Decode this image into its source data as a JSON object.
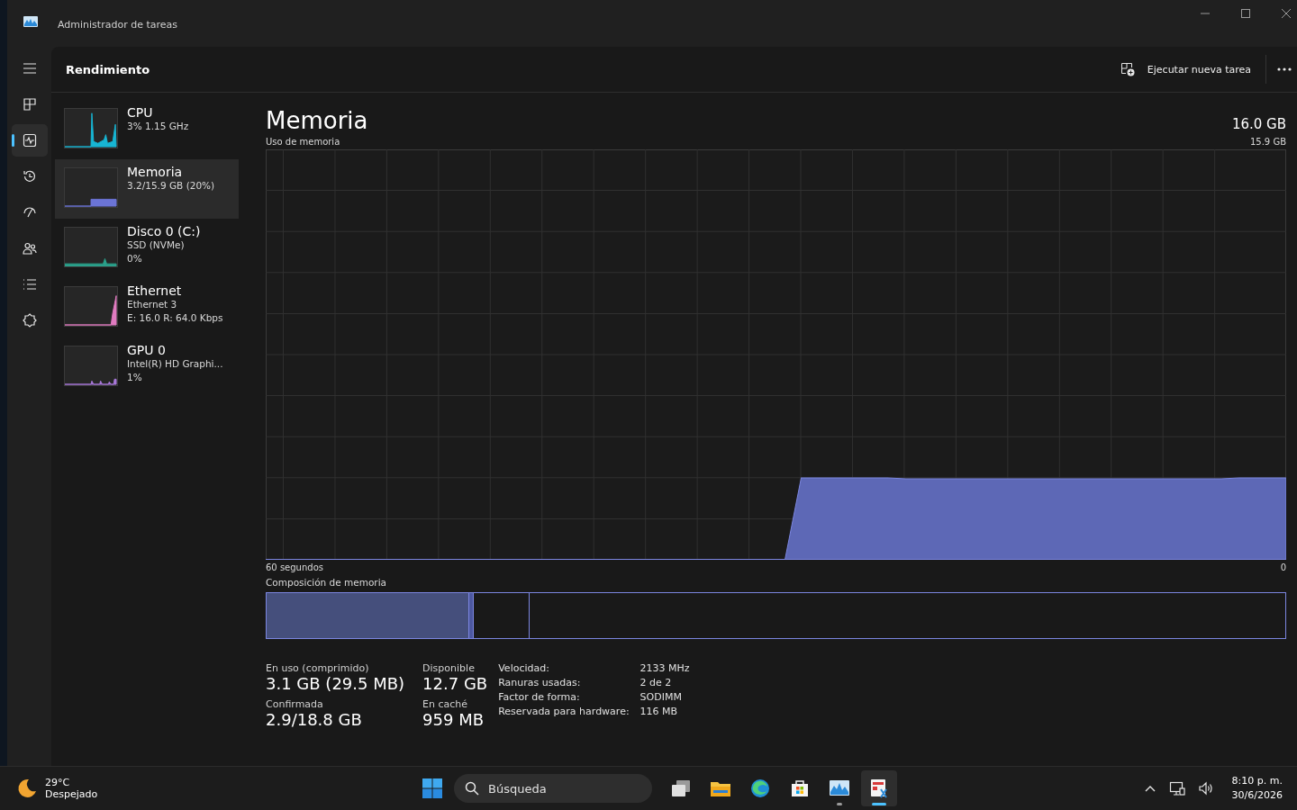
{
  "window": {
    "title": "Administrador de tareas"
  },
  "nav": [
    {
      "kind": "menu",
      "selected": false
    },
    {
      "kind": "processes",
      "selected": false
    },
    {
      "kind": "performance",
      "selected": true
    },
    {
      "kind": "history",
      "selected": false
    },
    {
      "kind": "startup",
      "selected": false
    },
    {
      "kind": "users",
      "selected": false
    },
    {
      "kind": "details",
      "selected": false
    },
    {
      "kind": "services",
      "selected": false
    }
  ],
  "header": {
    "title": "Rendimiento",
    "run_task": "Ejecutar nueva tarea"
  },
  "resources": [
    {
      "name": "CPU",
      "lines": [
        "3%  1.15 GHz"
      ],
      "color": "#17b5d3",
      "selected": false,
      "kind": "spiky"
    },
    {
      "name": "Memoria",
      "lines": [
        "3.2/15.9 GB (20%)"
      ],
      "color": "#6b74d6",
      "selected": true,
      "kind": "step"
    },
    {
      "name": "Disco 0 (C:)",
      "lines": [
        "SSD (NVMe)",
        "0%"
      ],
      "color": "#2aa08a",
      "selected": false,
      "kind": "flat"
    },
    {
      "name": "Ethernet",
      "lines": [
        "Ethernet 3",
        "E: 16.0 R: 64.0 Kbps"
      ],
      "color": "#e07bc0",
      "selected": false,
      "kind": "rise"
    },
    {
      "name": "GPU 0",
      "lines": [
        "Intel(R) HD Graphi...",
        "1%"
      ],
      "color": "#a878d8",
      "selected": false,
      "kind": "bumps"
    }
  ],
  "detail": {
    "title": "Memoria",
    "capacity": "16.0 GB",
    "graph_label": "Uso de memoria",
    "graph_max": "15.9 GB",
    "time_label": "60 segundos",
    "time_end": "0",
    "composition_label": "Composición de memoria",
    "stats": [
      {
        "label": "En uso (comprimido)",
        "value": "3.1 GB (29.5 MB)"
      },
      {
        "label": "Disponible",
        "value": "12.7 GB"
      },
      {
        "label": "Confirmada",
        "value": "2.9/18.8 GB"
      },
      {
        "label": "En caché",
        "value": "959 MB"
      }
    ],
    "properties": [
      {
        "label": "Velocidad:",
        "value": "2133 MHz"
      },
      {
        "label": "Ranuras usadas:",
        "value": "2 de 2"
      },
      {
        "label": "Factor de forma:",
        "value": "SODIMM"
      },
      {
        "label": "Reservada para hardware:",
        "value": "116 MB"
      }
    ]
  },
  "taskbar": {
    "temperature": "29°C",
    "weather": "Despejado",
    "search": {
      "placeholder": "Búsqueda"
    },
    "apps": [
      {
        "kind": "taskview",
        "running": false,
        "active": false
      },
      {
        "kind": "explorer",
        "running": false,
        "active": false
      },
      {
        "kind": "edge",
        "running": false,
        "active": false
      },
      {
        "kind": "store",
        "running": false,
        "active": false
      },
      {
        "kind": "monitor",
        "running": true,
        "active": false
      },
      {
        "kind": "taskmgr",
        "running": true,
        "active": true
      }
    ],
    "time": "8:10 p. m.",
    "date": "30/6/2026"
  }
}
